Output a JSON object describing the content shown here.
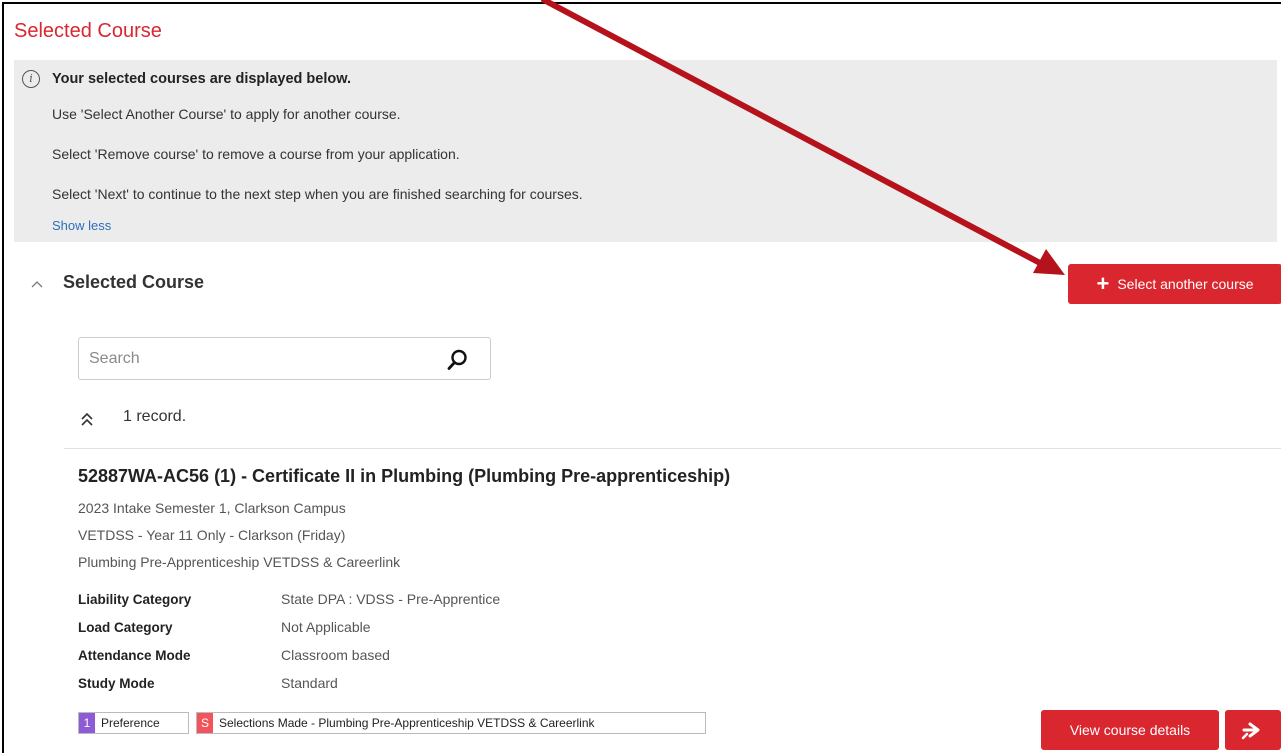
{
  "page": {
    "title": "Selected Course"
  },
  "info": {
    "heading": "Your selected courses are displayed below.",
    "lines": [
      "Use 'Select Another Course' to apply for another course.",
      "Select 'Remove course' to remove a course from your application.",
      "Select 'Next' to continue to the next step when you are finished searching for courses."
    ],
    "toggle_label": "Show less"
  },
  "section": {
    "title": "Selected Course",
    "select_button_label": "Select another course"
  },
  "search": {
    "placeholder": "Search",
    "value": ""
  },
  "records": {
    "count_label": "1 record."
  },
  "course": {
    "title": "52887WA-AC56 (1) - Certificate II in Plumbing (Plumbing Pre-apprenticeship)",
    "intake": "2023 Intake Semester 1, Clarkson Campus",
    "group": "VETDSS - Year 11 Only - Clarkson (Friday)",
    "program": "Plumbing Pre-Apprenticeship VETDSS & Careerlink",
    "details": [
      {
        "label": "Liability Category",
        "value": "State DPA : VDSS - Pre-Apprentice"
      },
      {
        "label": "Load Category",
        "value": "Not Applicable"
      },
      {
        "label": "Attendance Mode",
        "value": "Classroom based"
      },
      {
        "label": "Study Mode",
        "value": "Standard"
      }
    ],
    "tags": [
      {
        "badge": "1",
        "text": "Preference",
        "color": "#8e5bd6"
      },
      {
        "badge": "S",
        "text": "Selections Made - Plumbing Pre-Apprenticeship VETDSS & Careerlink",
        "color": "#f2545b"
      }
    ],
    "view_button_label": "View course details"
  },
  "colors": {
    "accent": "#d9262f",
    "panel_bg": "#ececec",
    "link": "#2a6ebb",
    "annotation_arrow": "#b5121b"
  },
  "icons": [
    "info-icon",
    "chevron-up-icon",
    "plus-icon",
    "search-icon",
    "double-chevron-up-icon",
    "next-arrow-icon"
  ]
}
